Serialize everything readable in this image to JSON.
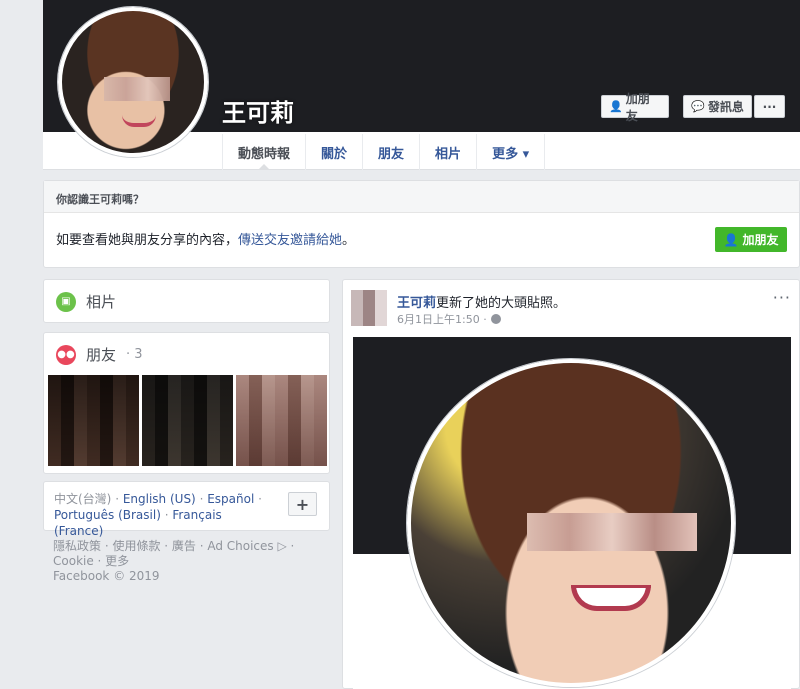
{
  "profile": {
    "name": "王可莉",
    "add_friend_label": "加朋友",
    "message_label": "發訊息",
    "more_label": "···"
  },
  "tabs": [
    {
      "label": "動態時報"
    },
    {
      "label": "關於"
    },
    {
      "label": "朋友"
    },
    {
      "label": "相片"
    },
    {
      "label": "更多 ▾"
    }
  ],
  "know_box": {
    "header": "你認識王可莉嗎？",
    "text": "如要查看她與朋友分享的內容，",
    "link": "傳送交友邀請給她",
    "end": "。",
    "button": "加朋友"
  },
  "sidebar": {
    "photos_label": "相片",
    "friends_label": "朋友",
    "friends_count": "· 3"
  },
  "languages": {
    "current": "中文(台灣)",
    "options": [
      "English (US)",
      "Español",
      "Português (Brasil)",
      "Français (France)"
    ],
    "plus": "+"
  },
  "footer": {
    "links": "隱私政策 · 使用條款 · 廣告 · Ad Choices ▷ · Cookie · 更多",
    "copyright": "Facebook © 2019"
  },
  "post": {
    "author": "王可莉",
    "action": "更新了她的大頭貼照。",
    "time": "6月1日上午1:50 ·",
    "more": "···"
  },
  "colors": {
    "link": "#365899",
    "green": "#42b72a",
    "background": "#e9ebee"
  }
}
